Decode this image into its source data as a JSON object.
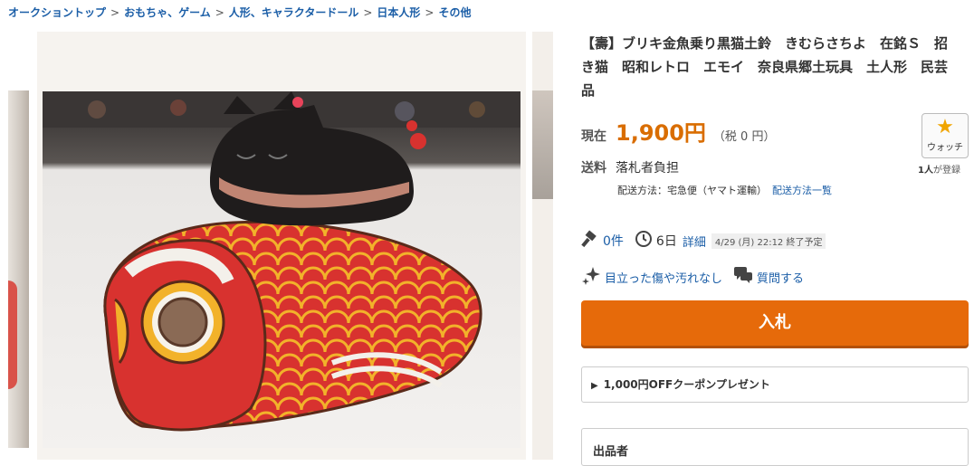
{
  "breadcrumb": [
    "オークショントップ",
    "おもちゃ、ゲーム",
    "人形、キャラクタードール",
    "日本人形",
    "その他"
  ],
  "breadcrumb_sep": ">",
  "item": {
    "title": "【壽】ブリキ金魚乗り黒猫土鈴　きむらさちよ　在銘Ｓ　招き猫　昭和レトロ　エモイ　奈良県郷土玩具　土人形　民芸品"
  },
  "price": {
    "label": "現在",
    "value": "1,900円",
    "tax": "（税 0 円）"
  },
  "watch": {
    "label": "ウォッチ",
    "count": "1人",
    "count_suffix": "が登録"
  },
  "shipping": {
    "label": "送料",
    "value": "落札者負担",
    "method": "配送方法：宅急便（ヤマト運輸）",
    "method_link": "配送方法一覧"
  },
  "auction": {
    "bids": "0件",
    "days_left": "6日",
    "detail_link": "詳細",
    "end_time": "4/29 (月) 22:12 終了予定"
  },
  "condition": {
    "text": "目立った傷や汚れなし",
    "question": "質問する"
  },
  "bid_button": "入札",
  "coupon": "1,000円OFFクーポンプレゼント",
  "seller_label": "出品者",
  "colors": {
    "accent_orange": "#e66a0a",
    "price_orange": "#d96d00",
    "link_blue": "#1b5ea7"
  },
  "icons": [
    "hammer-icon",
    "clock-icon",
    "sparkle-icon",
    "chat-icon",
    "star-icon",
    "triangle-right-icon"
  ]
}
